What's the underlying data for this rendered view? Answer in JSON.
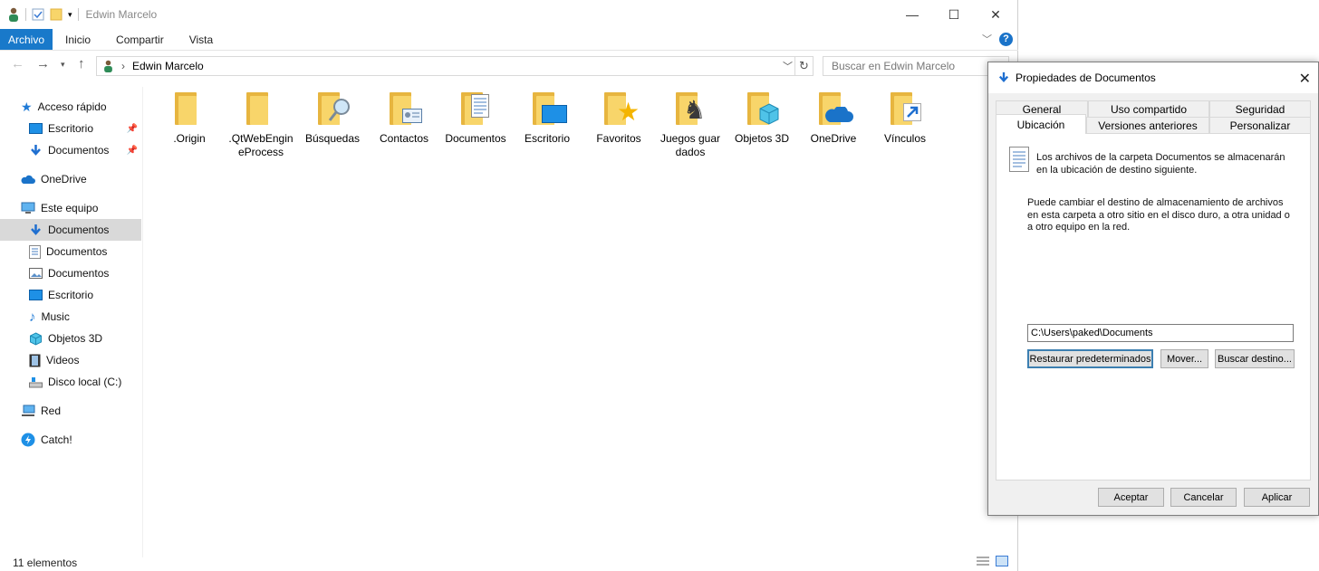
{
  "window": {
    "title": "Edwin Marcelo",
    "minimize_glyph": "—",
    "maximize_glyph": "☐",
    "close_glyph": "✕"
  },
  "ribbon": {
    "tabs": [
      "Archivo",
      "Inicio",
      "Compartir",
      "Vista"
    ],
    "help_label": "?"
  },
  "address": {
    "path": "Edwin Marcelo",
    "search_placeholder": "Buscar en Edwin Marcelo"
  },
  "nav_pane": {
    "quick_access": "Acceso rápido",
    "quick_items": [
      "Escritorio",
      "Documentos"
    ],
    "onedrive": "OneDrive",
    "this_pc": "Este equipo",
    "pc_items": [
      "Documentos",
      "Documentos",
      "Documentos",
      "Escritorio",
      "Music",
      "Objetos 3D",
      "Videos",
      "Disco local (C:)"
    ],
    "network": "Red",
    "catch": "Catch!"
  },
  "folders": [
    {
      "label": ".Origin",
      "badge": "none"
    },
    {
      "label": ".QtWebEngineProcess",
      "badge": "none"
    },
    {
      "label": "Búsquedas",
      "badge": "magnifier-icon"
    },
    {
      "label": "Contactos",
      "badge": "contact-card-icon"
    },
    {
      "label": "Documentos",
      "badge": "document-icon"
    },
    {
      "label": "Escritorio",
      "badge": "desktop-icon"
    },
    {
      "label": "Favoritos",
      "badge": "star-icon"
    },
    {
      "label": "Juegos guardados",
      "badge": "chess-icon"
    },
    {
      "label": "Objetos 3D",
      "badge": "cube-icon"
    },
    {
      "label": "OneDrive",
      "badge": "cloud-icon"
    },
    {
      "label": "Vínculos",
      "badge": "shortcut-arrow-icon"
    }
  ],
  "status": {
    "item_count": "11 elementos"
  },
  "dialog": {
    "title": "Propiedades de Documentos",
    "tabs_row1": [
      "General",
      "Uso compartido",
      "Seguridad"
    ],
    "tabs_row2": [
      "Ubicación",
      "Versiones anteriores",
      "Personalizar"
    ],
    "intro_text": "Los archivos de la carpeta Documentos se almacenarán en la ubicación de destino siguiente.",
    "help_text": "Puede cambiar el destino de almacenamiento de archivos en esta carpeta a otro sitio en el disco duro, a otra unidad o a otro equipo en la red.",
    "path_value": "C:\\Users\\paked\\Documents",
    "restore_button": "Restaurar predeterminados",
    "move_button": "Mover...",
    "find_button": "Buscar destino...",
    "ok_button": "Aceptar",
    "cancel_button": "Cancelar",
    "apply_button": "Aplicar"
  },
  "colors": {
    "accent": "#1979ca",
    "folder_back": "#e7b53f",
    "folder_front": "#f8d56a",
    "selection": "#d9d9d9"
  }
}
